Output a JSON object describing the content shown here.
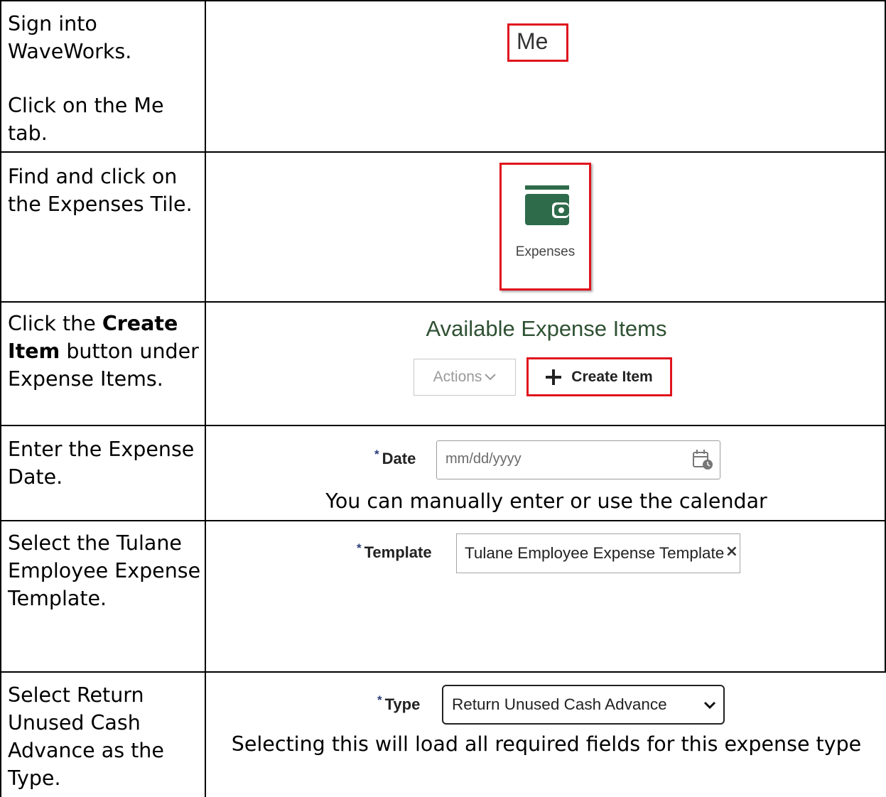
{
  "rows": [
    {
      "instructions": [
        "Sign into WaveWorks.",
        "Click on the Me tab."
      ],
      "me_tab_label": "Me"
    },
    {
      "instruction": "Find and click on the Expenses Tile.",
      "tile_icon": "wallet-icon",
      "tile_label": "Expenses"
    },
    {
      "instruction_before": "Click the ",
      "instruction_bold": "Create Item",
      "instruction_after": " button under Expense Items.",
      "section_title": "Available Expense Items",
      "actions_label": "Actions",
      "create_label": "Create Item"
    },
    {
      "instruction": "Enter the Expense Date.",
      "field_label": "Date",
      "placeholder": "mm/dd/yyyy",
      "caption": "You can manually enter or use the calendar"
    },
    {
      "instruction": "Select the Tulane Employee Expense Template.",
      "field_label": "Template",
      "value": "Tulane Employee Expense Template"
    },
    {
      "instruction": "Select Return Unused Cash Advance as the Type.",
      "field_label": "Type",
      "value": "Return Unused Cash Advance",
      "caption": "Selecting this will load all required fields for this expense type"
    }
  ],
  "colors": {
    "highlight": "#e0141e",
    "brand_green": "#2e6b4a",
    "title_green": "#2f5133"
  }
}
